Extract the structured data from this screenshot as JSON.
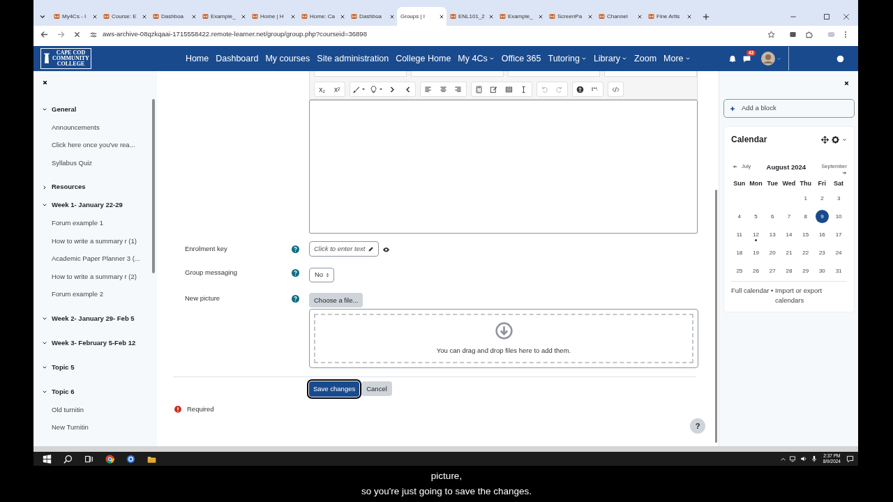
{
  "browser": {
    "tabs": [
      {
        "label": "My4Cs - I",
        "selected": false
      },
      {
        "label": "Course: E",
        "selected": false
      },
      {
        "label": "Dashboa",
        "selected": false
      },
      {
        "label": "Example_",
        "selected": false
      },
      {
        "label": "Home | H",
        "selected": false
      },
      {
        "label": "Home: Ca",
        "selected": false
      },
      {
        "label": "Dashboa",
        "selected": false
      },
      {
        "label": "Groups | I",
        "selected": true
      },
      {
        "label": "ENL101_2",
        "selected": false
      },
      {
        "label": "Example_",
        "selected": false
      },
      {
        "label": "ScreenPa",
        "selected": false
      },
      {
        "label": "Channel",
        "selected": false
      },
      {
        "label": "Fine Artis",
        "selected": false
      }
    ],
    "address": "aws-archive-08qzkqaai-1715558422.remote-learner.net/group/group.php?courseid=36898"
  },
  "navbar": {
    "logo": [
      "CAPE COD",
      "COMMUNITY",
      "COLLEGE"
    ],
    "links": [
      {
        "label": "Home",
        "has_menu": false
      },
      {
        "label": "Dashboard",
        "has_menu": false
      },
      {
        "label": "My courses",
        "has_menu": false
      },
      {
        "label": "Site administration",
        "has_menu": false
      },
      {
        "label": "College Home",
        "has_menu": false
      },
      {
        "label": "My 4Cs",
        "has_menu": true
      },
      {
        "label": "Office 365",
        "has_menu": false
      },
      {
        "label": "Tutoring",
        "has_menu": true
      },
      {
        "label": "Library",
        "has_menu": true
      },
      {
        "label": "Zoom",
        "has_menu": false
      },
      {
        "label": "More",
        "has_menu": true
      }
    ],
    "message_count": "43",
    "toggle": {
      "on": false
    }
  },
  "course_index": [
    {
      "title": "General",
      "expanded": true,
      "children": [
        {
          "label": "Announcements"
        },
        {
          "label": "Click here once you've rea..."
        },
        {
          "label": "Syllabus Quiz"
        }
      ]
    },
    {
      "title": "Resources",
      "expanded": false
    },
    {
      "title": "Week 1- January 22-29",
      "expanded": true,
      "children": [
        {
          "label": "Forum example 1"
        },
        {
          "label": "How to write a summary r (1)"
        },
        {
          "label": "Academic Paper Planner 3 (..."
        },
        {
          "label": "How to write a summary r (2)"
        },
        {
          "label": "Forum example 2"
        }
      ]
    },
    {
      "title": "Week 2- January 29- Feb 5",
      "expanded": true
    },
    {
      "title": "Week 3- February 5-Feb 12",
      "expanded": true
    },
    {
      "title": "Topic 5",
      "expanded": true
    },
    {
      "title": "Topic 6",
      "expanded": true,
      "children": [
        {
          "label": "Old turnitin"
        },
        {
          "label": "New Turnitin"
        }
      ]
    }
  ],
  "editor_toolbar": [
    {
      "label": "x₂"
    },
    {
      "label": "x²"
    }
  ],
  "form": {
    "fields": [
      {
        "kind": "inplace",
        "label": "Enrolment key",
        "value": "Click to enter text"
      },
      {
        "kind": "select",
        "label": "Group messaging",
        "value": "No"
      },
      {
        "kind": "file",
        "label": "New picture",
        "button": "Choose a file...",
        "dropzone": "You can drag and drop files here to add them."
      }
    ],
    "buttons": [
      {
        "label": "Save changes",
        "kind": "primary",
        "focused": true
      },
      {
        "label": "Cancel",
        "kind": "secondary",
        "focused": false
      }
    ],
    "required_note": "Required"
  },
  "help_button": "?",
  "blocks": {
    "add_block": "Add a block",
    "calendar": {
      "title": "Calendar",
      "prev": "July",
      "month": "August 2024",
      "next": "September",
      "weekdays": [
        "Sun",
        "Mon",
        "Tue",
        "Wed",
        "Thu",
        "Fri",
        "Sat"
      ],
      "weeks": [
        [
          {
            "day": "1",
            "today": false,
            "has_event": false
          },
          {
            "day": "2",
            "today": false,
            "has_event": false
          },
          {
            "day": "3",
            "today": false,
            "has_event": false
          }
        ],
        [
          {
            "day": "4",
            "today": false,
            "has_event": false
          },
          {
            "day": "5",
            "today": false,
            "has_event": false
          },
          {
            "day": "6",
            "today": false,
            "has_event": false
          },
          {
            "day": "7",
            "today": false,
            "has_event": false
          },
          {
            "day": "8",
            "today": false,
            "has_event": false
          },
          {
            "day": "9",
            "today": true,
            "has_event": false
          },
          {
            "day": "10",
            "today": false,
            "has_event": false
          }
        ],
        [
          {
            "day": "11",
            "today": false,
            "has_event": false
          },
          {
            "day": "12",
            "today": false,
            "has_event": true
          },
          {
            "day": "13",
            "today": false,
            "has_event": false
          },
          {
            "day": "14",
            "today": false,
            "has_event": false
          },
          {
            "day": "15",
            "today": false,
            "has_event": false
          },
          {
            "day": "16",
            "today": false,
            "has_event": false
          },
          {
            "day": "17",
            "today": false,
            "has_event": false
          }
        ],
        [
          {
            "day": "18",
            "today": false,
            "has_event": false
          },
          {
            "day": "19",
            "today": false,
            "has_event": false
          },
          {
            "day": "20",
            "today": false,
            "has_event": false
          },
          {
            "day": "21",
            "today": false,
            "has_event": false
          },
          {
            "day": "22",
            "today": false,
            "has_event": false
          },
          {
            "day": "23",
            "today": false,
            "has_event": false
          },
          {
            "day": "24",
            "today": false,
            "has_event": false
          }
        ],
        [
          {
            "day": "25",
            "today": false,
            "has_event": false
          },
          {
            "day": "26",
            "today": false,
            "has_event": false
          },
          {
            "day": "27",
            "today": false,
            "has_event": false
          },
          {
            "day": "28",
            "today": false,
            "has_event": false
          },
          {
            "day": "29",
            "today": false,
            "has_event": false
          },
          {
            "day": "30",
            "today": false,
            "has_event": false
          },
          {
            "day": "31",
            "today": false,
            "has_event": false
          }
        ]
      ],
      "footer": [
        {
          "label": "Full calendar"
        },
        {
          "label": "Import or export calendars"
        }
      ],
      "separator": "•"
    }
  },
  "taskbar": {
    "time": "2:37 PM",
    "date": "8/9/2024"
  },
  "captions": [
    "picture,",
    "so you're just going to save the changes."
  ]
}
